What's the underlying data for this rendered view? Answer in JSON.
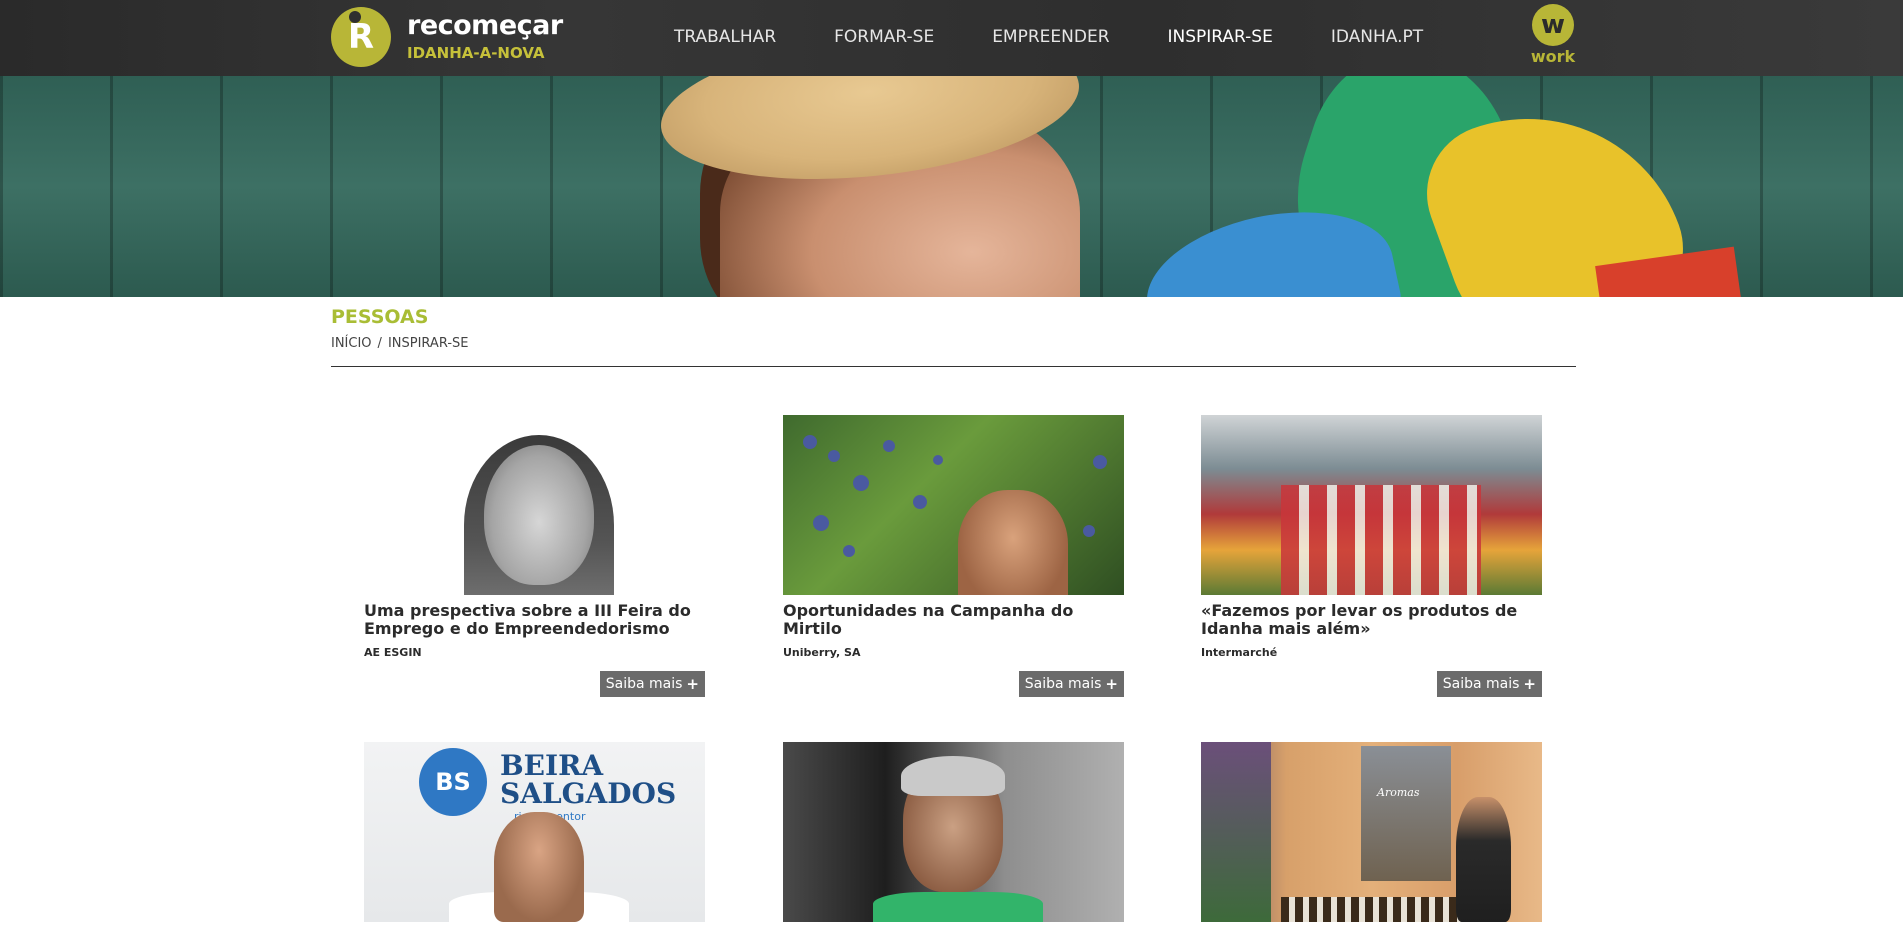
{
  "brand": {
    "logo_letter": "R",
    "title": "recomeçar",
    "subtitle": "IDANHA-A-NOVA",
    "accent_color": "#b8b637"
  },
  "nav": {
    "items": [
      {
        "label": "TRABALHAR"
      },
      {
        "label": "FORMAR-SE"
      },
      {
        "label": "EMPREENDER"
      },
      {
        "label": "INSPIRAR-SE",
        "active": true
      },
      {
        "label": "IDANHA.PT"
      }
    ]
  },
  "work_logo": {
    "letter": "w",
    "label": "work"
  },
  "page": {
    "title": "PESSOAS",
    "title_color": "#a9bd35",
    "breadcrumb": [
      {
        "label": "INÍCIO"
      },
      {
        "label": "INSPIRAR-SE"
      }
    ],
    "breadcrumb_separator": "/"
  },
  "cards": [
    {
      "title": "Uma prespectiva sobre a III Feira do Emprego e do Empreendedorismo",
      "org": "AE ESGIN",
      "button": "Saiba mais",
      "image_icon": "portrait-photo-icon"
    },
    {
      "title": "Oportunidades na Campanha do Mirtilo",
      "org": "Uniberry, SA",
      "button": "Saiba mais",
      "image_icon": "blueberry-photo-icon"
    },
    {
      "title": "«Fazemos por levar os produtos de Idanha mais além»",
      "org": "Intermarché",
      "button": "Saiba mais",
      "image_icon": "supermarket-photo-icon"
    },
    {
      "title": "",
      "org": "",
      "image_icon": "beira-salgados-photo-icon",
      "image_text": {
        "badge": "BS",
        "brand_line1": "BEIRA",
        "brand_line2": "SALGADOS",
        "brand_sub": "rio Alimentor"
      }
    },
    {
      "title": "",
      "org": "",
      "image_icon": "man-green-shirt-photo-icon"
    },
    {
      "title": "",
      "org": "",
      "image_icon": "aromas-stand-photo-icon",
      "image_text": {
        "sign": "Aromas"
      }
    }
  ],
  "button_icon": "plus-icon"
}
